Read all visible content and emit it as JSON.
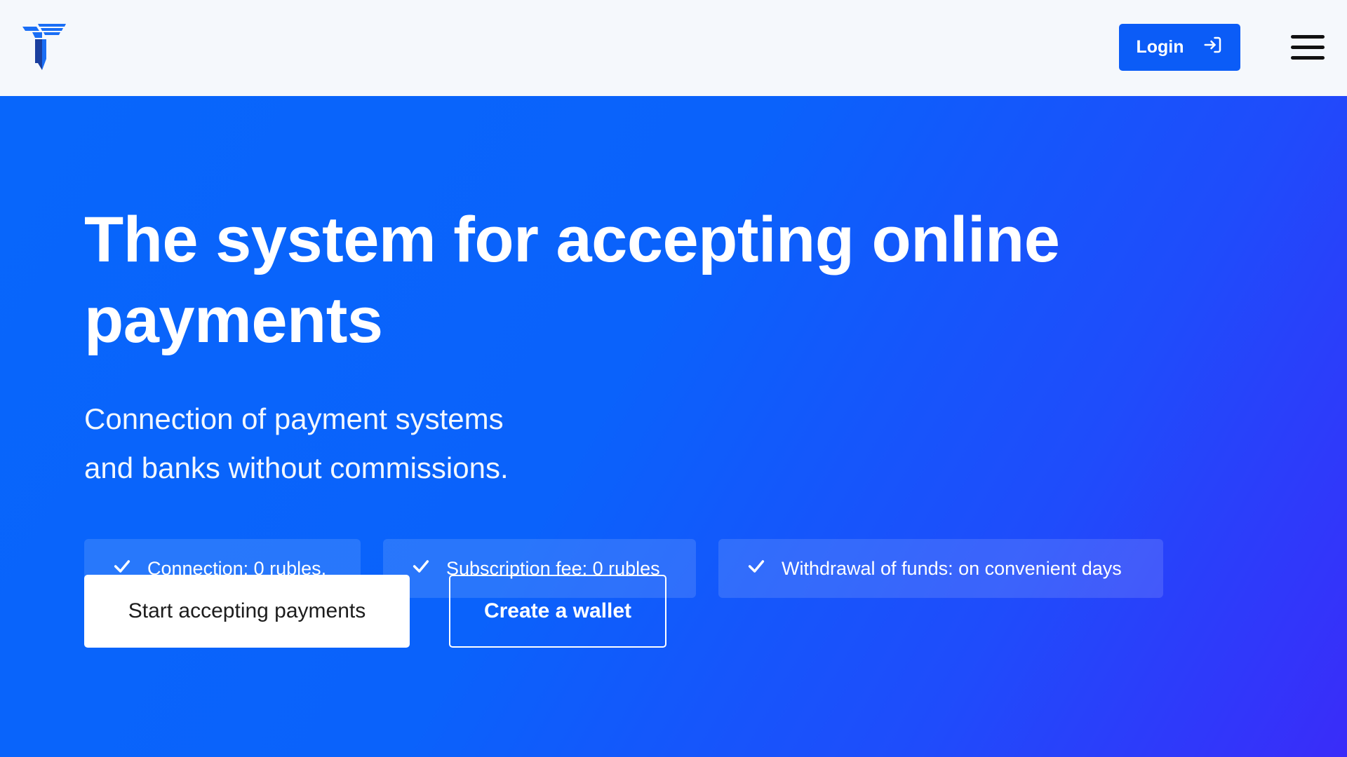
{
  "header": {
    "logo": "brand-logo-icon",
    "login_label": "Login",
    "login_icon": "login-arrow-icon",
    "menu_icon": "hamburger-menu-icon"
  },
  "hero": {
    "title": "The system for accepting online payments",
    "subtitle_line1": "Connection of payment systems",
    "subtitle_line2": "and banks without commissions.",
    "features": [
      {
        "icon": "check-icon",
        "label": "Connection: 0 rubles."
      },
      {
        "icon": "check-icon",
        "label": "Subscription fee: 0 rubles"
      },
      {
        "icon": "check-icon",
        "label": "Withdrawal of funds: on convenient days"
      }
    ],
    "primary_button": "Start accepting payments",
    "secondary_button": "Create a wallet"
  },
  "colors": {
    "accent": "#0b5cf7",
    "hero_gradient_start": "#0866fb",
    "hero_gradient_end": "#3a2cf9",
    "header_bg": "#f5f8fc"
  }
}
